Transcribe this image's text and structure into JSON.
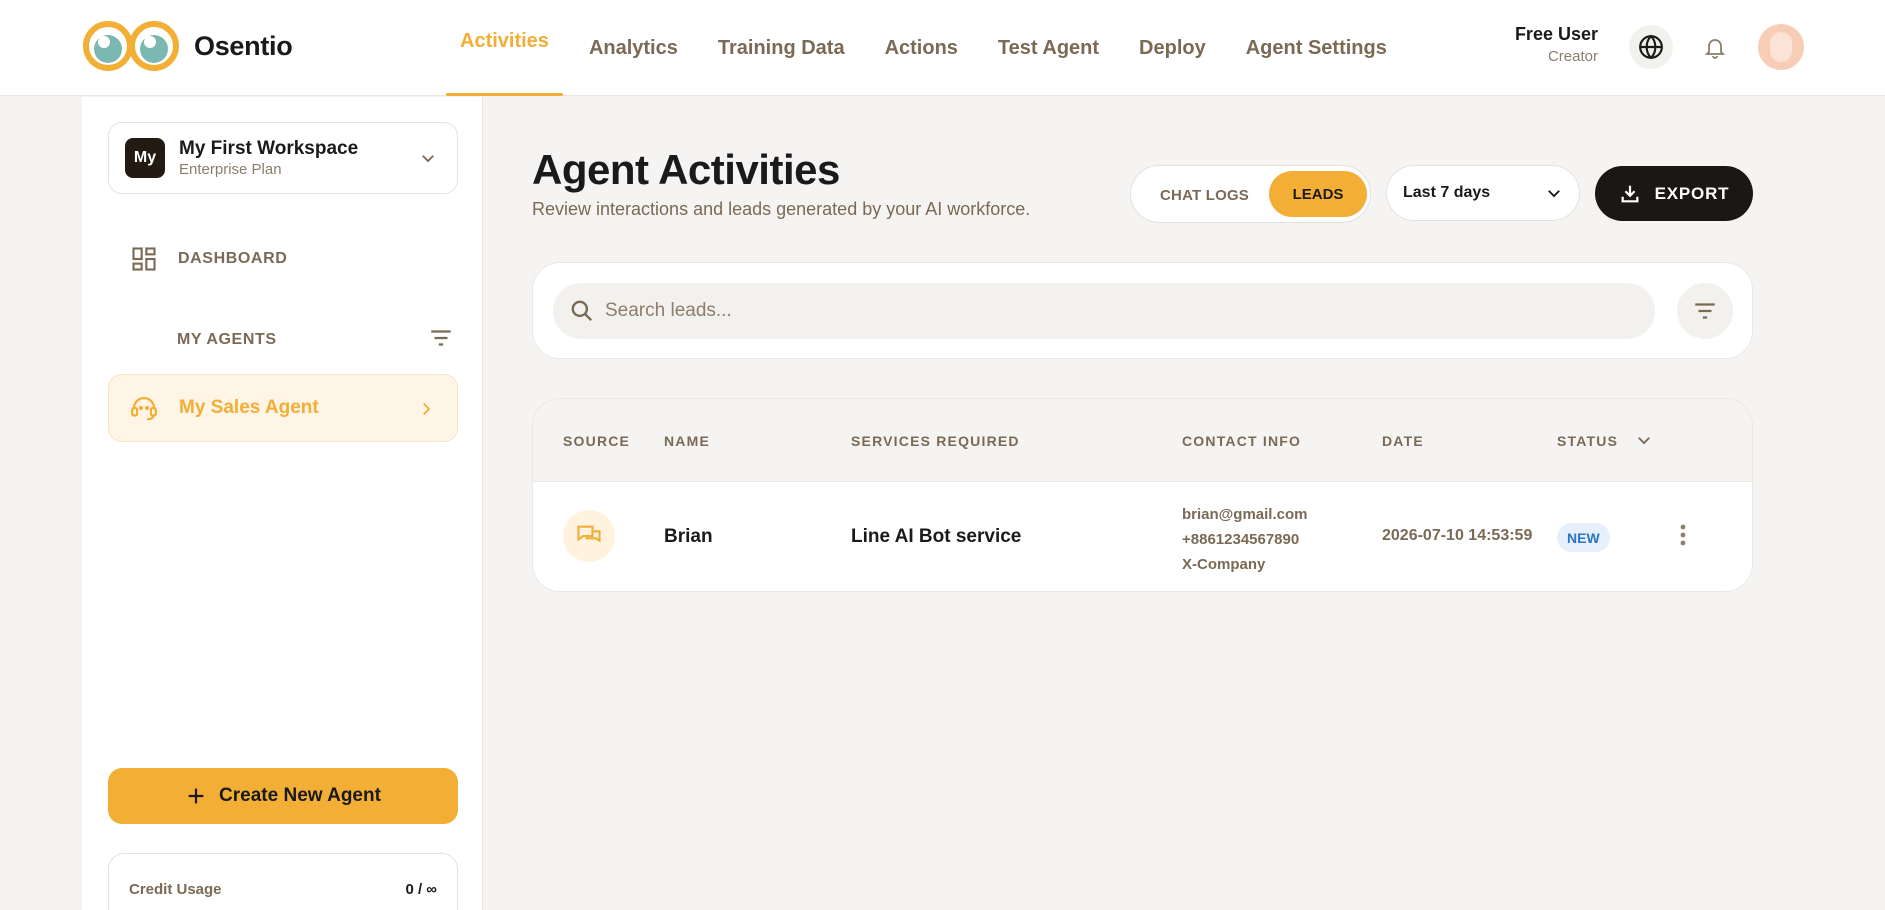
{
  "app": {
    "name": "Osentio"
  },
  "nav": {
    "items": [
      {
        "label": "Activities",
        "active": true
      },
      {
        "label": "Analytics"
      },
      {
        "label": "Training Data"
      },
      {
        "label": "Actions"
      },
      {
        "label": "Test Agent"
      },
      {
        "label": "Deploy"
      },
      {
        "label": "Agent Settings"
      }
    ]
  },
  "user": {
    "name": "Free User",
    "role": "Creator"
  },
  "sidebar": {
    "workspace": {
      "badge": "My",
      "name": "My First Workspace",
      "plan": "Enterprise Plan"
    },
    "dashboard_label": "DASHBOARD",
    "agents_header": "MY AGENTS",
    "agents": [
      {
        "label": "My Sales Agent"
      }
    ],
    "create_button": "Create New Agent",
    "credit": {
      "label": "Credit Usage",
      "value": "0 / ∞"
    }
  },
  "main": {
    "title": "Agent Activities",
    "subtitle": "Review interactions and leads generated by your AI workforce.",
    "toggle": {
      "chat_logs": "CHAT LOGS",
      "leads": "LEADS",
      "selected": "LEADS"
    },
    "date_range": "Last 7 days",
    "export_label": "EXPORT",
    "search": {
      "placeholder": "Search leads...",
      "value": ""
    },
    "table": {
      "columns": [
        "SOURCE",
        "NAME",
        "SERVICES REQUIRED",
        "CONTACT INFO",
        "DATE",
        "STATUS"
      ],
      "rows": [
        {
          "source_icon": "chat-icon",
          "name": "Brian",
          "service": "Line AI Bot service",
          "contact": [
            "brian@gmail.com",
            "+8861234567890",
            "X-Company"
          ],
          "date": "2026-07-10 14:53:59",
          "status": "NEW"
        }
      ]
    }
  },
  "colors": {
    "accent": "#f3ae35",
    "dark": "#1a1714",
    "muted_text": "#7a6a55",
    "status_new_bg": "#e6f0fb",
    "status_new_text": "#2a74c9"
  }
}
